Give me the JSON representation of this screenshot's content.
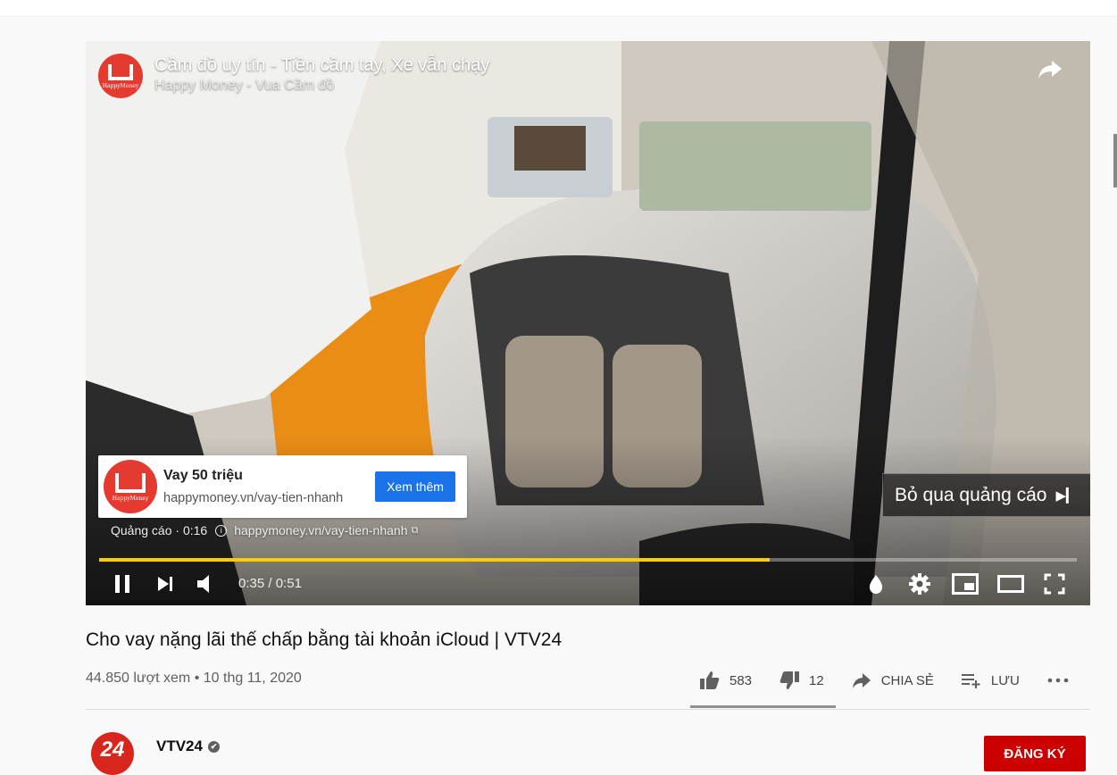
{
  "ad": {
    "title": "Cầm đồ uy tín - Tiền cầm tay, Xe vẫn chạy",
    "advertiser": "Happy Money - Vua Cầm đồ",
    "logo_text": "HappyMoney",
    "card": {
      "title": "Vay 50 triệu",
      "url": "happymoney.vn/vay-tien-nhanh",
      "button": "Xem thêm"
    },
    "label": "Quảng cáo · 0:16",
    "link": "happymoney.vn/vay-tien-nhanh",
    "skip": "Bỏ qua quảng cáo"
  },
  "player": {
    "time_current": "0:35",
    "time_separator": " / ",
    "time_total": "0:51",
    "progress_fraction": 0.686,
    "progress_color": "#ffcc00"
  },
  "video": {
    "title": "Cho vay nặng lãi thế chấp bằng tài khoản iCloud | VTV24",
    "views": "44.850 lượt xem",
    "separator": " • ",
    "date": "10 thg 11, 2020",
    "likes": "583",
    "dislikes": "12",
    "share_label": "CHIA SẺ",
    "save_label": "LƯU"
  },
  "channel": {
    "name": "VTV24",
    "avatar_text": "24",
    "subscribe_label": "ĐĂNG KÝ",
    "verified_mark": "✔"
  }
}
